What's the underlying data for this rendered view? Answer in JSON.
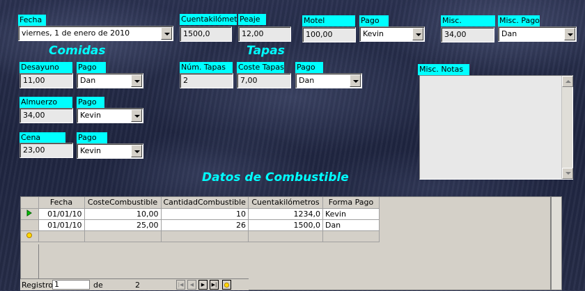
{
  "form": {
    "fecha": {
      "label": "Fecha",
      "value": "viernes, 1 de enero de 2010"
    },
    "cuentakm": {
      "label": "Cuentakilómetros",
      "value": "1500,0"
    },
    "peaje": {
      "label": "Peaje",
      "value": "12,00"
    },
    "motel": {
      "label": "Motel",
      "value": "100,00"
    },
    "pago_motel": {
      "label": "Pago",
      "value": "Kevin"
    },
    "misc": {
      "label": "Misc.",
      "value": "34,00"
    },
    "misc_pago": {
      "label": "Misc. Pago",
      "value": "Dan"
    }
  },
  "comidas": {
    "heading": "Comidas",
    "desayuno": {
      "label": "Desayuno",
      "value": "11,00",
      "pago_label": "Pago",
      "pago": "Dan"
    },
    "almuerzo": {
      "label": "Almuerzo",
      "value": "34,00",
      "pago_label": "Pago",
      "pago": "Kevin"
    },
    "cena": {
      "label": "Cena",
      "value": "23,00",
      "pago_label": "Pago",
      "pago": "Kevin"
    }
  },
  "tapas": {
    "heading": "Tapas",
    "num": {
      "label": "Núm. Tapas",
      "value": "2"
    },
    "coste": {
      "label": "Coste Tapas",
      "value": "7,00"
    },
    "pago": {
      "label": "Pago",
      "value": "Dan"
    }
  },
  "misc_notas": {
    "label": "Misc. Notas",
    "value": ""
  },
  "combustible": {
    "heading": "Datos de Combustible",
    "columns": [
      "Fecha",
      "CosteCombustible",
      "CantidadCombustible",
      "Cuentakilómetros",
      "Forma Pago"
    ],
    "rows": [
      [
        "01/01/10",
        "10,00",
        "10",
        "1234,0",
        "Kevin"
      ],
      [
        "01/01/10",
        "25,00",
        "26",
        "1500,0",
        "Dan"
      ]
    ]
  },
  "navigator": {
    "registro_label": "Registro",
    "registro_value": "1",
    "de_label": "de",
    "total": "2"
  },
  "colors": {
    "label_bg": "#00ffff",
    "heading": "#00ffff"
  }
}
